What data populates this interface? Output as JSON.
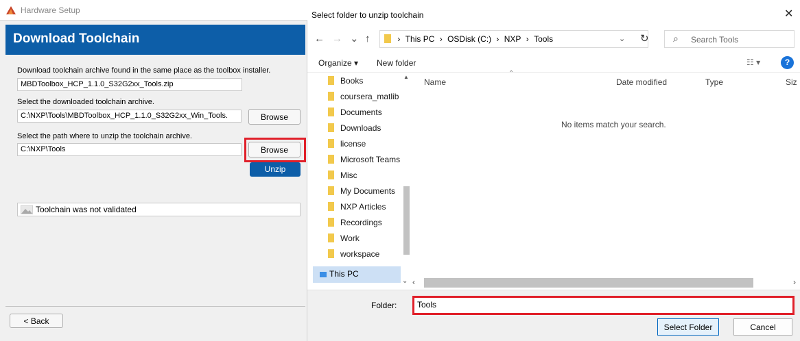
{
  "hardware_setup": {
    "window_title": "Hardware Setup",
    "banner_title": "Download Toolchain",
    "download_label": "Download toolchain archive found in the same place as the toolbox installer.",
    "archive_name": "MBDToolbox_HCP_1.1.0_S32G2xx_Tools.zip",
    "downloaded_label": "Select the downloaded toolchain archive.",
    "downloaded_path": "C:\\NXP\\Tools\\MBDToolbox_HCP_1.1.0_S32G2xx_Win_Tools.",
    "browse_label": "Browse",
    "unzip_path_label": "Select the path where to unzip the toolchain archive.",
    "unzip_path": "C:\\NXP\\Tools",
    "unzip_button": "Unzip",
    "validation_status": "Toolchain was not validated",
    "back_button": "< Back"
  },
  "dialog": {
    "title": "Select folder to unzip toolchain",
    "close_glyph": "✕",
    "nav": {
      "back": "←",
      "forward": "→",
      "recent": "⌄",
      "up": "↑"
    },
    "breadcrumb": [
      "This PC",
      "OSDisk (C:)",
      "NXP",
      "Tools"
    ],
    "breadcrumb_separator": "›",
    "search_placeholder": "Search Tools",
    "toolbar": {
      "organize": "Organize ▾",
      "new_folder": "New folder",
      "view": "☷ ▾",
      "help": "?"
    },
    "nav_items": [
      "Books",
      "coursera_matlib",
      "Documents",
      "Downloads",
      "license",
      "Microsoft Teams",
      "Misc",
      "My Documents",
      "NXP Articles",
      "Recordings",
      "Work",
      "workspace"
    ],
    "nav_this_pc": "This PC",
    "columns": {
      "name": "Name",
      "date_modified": "Date modified",
      "type": "Type",
      "size": "Siz"
    },
    "empty_message": "No items match your search.",
    "folder_label": "Folder:",
    "folder_value": "Tools",
    "select_button": "Select Folder",
    "cancel_button": "Cancel"
  },
  "colors": {
    "accent_blue": "#0d5ea8",
    "highlight_red": "#e0202a",
    "selected_nav": "#cde0f5",
    "folder_yellow": "#f2c94c"
  }
}
